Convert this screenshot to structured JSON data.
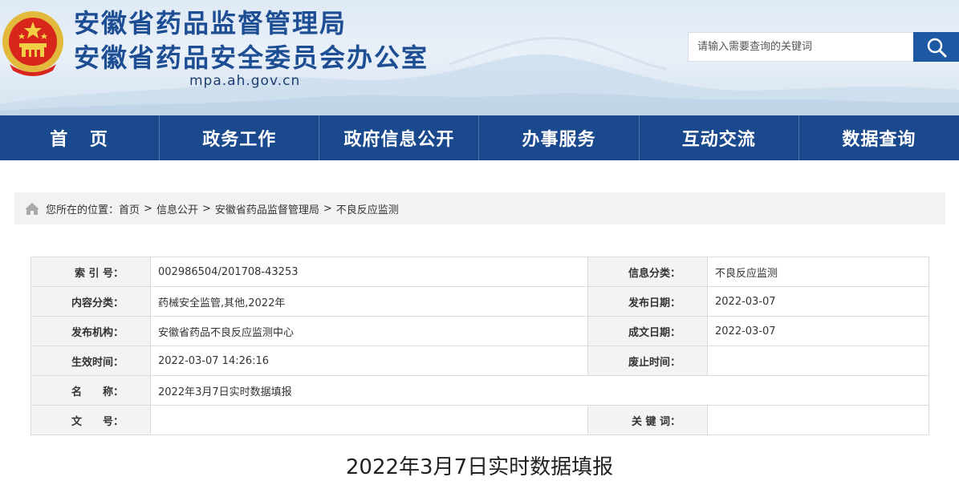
{
  "header": {
    "title_line1": "安徽省药品监督管理局",
    "title_line2": "安徽省药品安全委员会办公室",
    "domain": "mpa.ah.gov.cn",
    "emblem_icon": "national-emblem-icon",
    "colors": {
      "title": "#1d4d93",
      "nav_bg": "#1a4a8d",
      "search_btn": "#1d58a2"
    }
  },
  "search": {
    "placeholder": "请输入需要查询的关键词",
    "value": "",
    "button_icon": "search-icon"
  },
  "nav": {
    "items": [
      {
        "label": "首 页"
      },
      {
        "label": "政务工作"
      },
      {
        "label": "政府信息公开"
      },
      {
        "label": "办事服务"
      },
      {
        "label": "互动交流"
      },
      {
        "label": "数据查询"
      }
    ]
  },
  "breadcrumb": {
    "icon": "home-icon",
    "prefix": "您所在的位置：",
    "items": [
      "首页",
      "信息公开",
      "安徽省药品监督管理局",
      "不良反应监测"
    ],
    "separator": ">"
  },
  "info": {
    "index_label": "索 引 号：",
    "index_value": "002986504/201708-43253",
    "category_label": "信息分类：",
    "category_value": "不良反应监测",
    "content_type_label": "内容分类：",
    "content_type_value": "药械安全监管,其他,2022年",
    "publish_date_label": "发布日期：",
    "publish_date_value": "2022-03-07",
    "publisher_label": "发布机构：",
    "publisher_value": "安徽省药品不良反应监测中心",
    "written_date_label": "成文日期：",
    "written_date_value": "2022-03-07",
    "effective_label": "生效时间：",
    "effective_value": "2022-03-07 14:26:16",
    "expire_label": "废止时间：",
    "expire_value": "",
    "name_label": "名　　称：",
    "name_value": "2022年3月7日实时数据填报",
    "doc_no_label": "文　　号：",
    "doc_no_value": "",
    "keywords_label": "关 键 词：",
    "keywords_value": ""
  },
  "article": {
    "title": "2022年3月7日实时数据填报"
  }
}
